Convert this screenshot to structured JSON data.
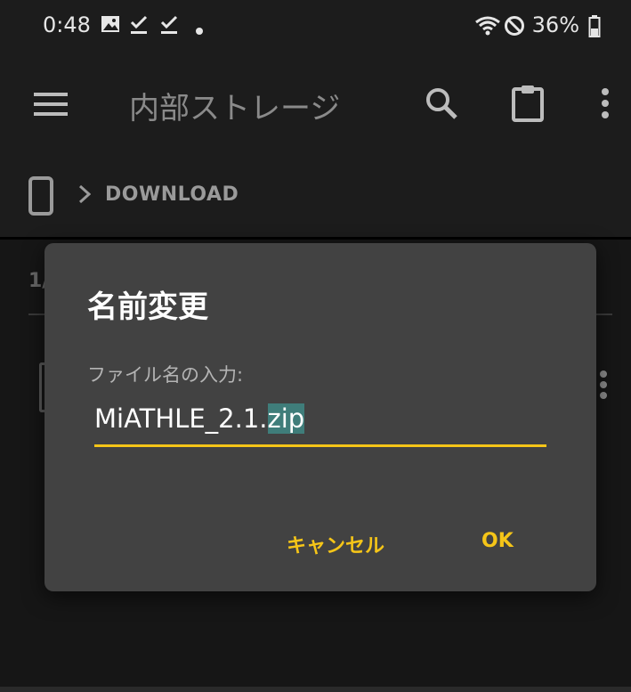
{
  "status_bar": {
    "time": "0:48",
    "battery": "36%",
    "icons": [
      "image-icon",
      "download-done-icon",
      "download-done-icon",
      "dot-icon",
      "wifi-icon",
      "do-not-disturb-icon",
      "battery-icon"
    ]
  },
  "app_bar": {
    "title": "内部ストレージ",
    "icons": [
      "menu-icon",
      "search-icon",
      "clipboard-icon",
      "more-vert-icon"
    ]
  },
  "breadcrumb": {
    "icons": [
      "phone-icon",
      "chevron-right-icon"
    ],
    "path": "DOWNLOAD"
  },
  "list": {
    "count_fragment": "1/"
  },
  "dialog": {
    "title": "名前変更",
    "field_label": "ファイル名の入力:",
    "input_value_prefix": "MiATHLE_2.1.",
    "input_value_selected": "zip",
    "cancel_label": "キャンセル",
    "ok_label": "OK"
  },
  "colors": {
    "accent": "#f5c518",
    "dialog_bg": "#424242",
    "background": "#1c1c1c",
    "selection": "#3f7d7a"
  }
}
